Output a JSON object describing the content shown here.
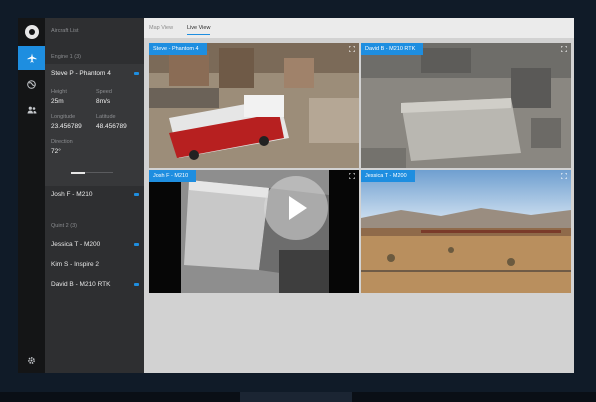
{
  "sidebar_panel": {
    "header": "Aircraft List",
    "groups": [
      {
        "label": "Engine 1 (3)"
      },
      {
        "label": "Quint 2 (3)"
      }
    ],
    "selected": {
      "name": "Steve P - Phantom 4",
      "fields": {
        "height_label": "Height",
        "height_value": "25m",
        "speed_label": "Speed",
        "speed_value": "8m/s",
        "longitude_label": "Longitude",
        "longitude_value": "23.456789",
        "latitude_label": "Latitude",
        "latitude_value": "48.456789",
        "direction_label": "Direction",
        "direction_value": "72°"
      }
    },
    "items": [
      {
        "name": "Josh F - M210"
      },
      {
        "name": "Jessica T - M200"
      },
      {
        "name": "Kim S - Inspire 2"
      },
      {
        "name": "David B - M210 RTK"
      }
    ]
  },
  "tabs": {
    "map": "Map View",
    "live": "Live View"
  },
  "feeds": [
    {
      "label": "Steve - Phantom 4"
    },
    {
      "label": "David B - M210 RTK"
    },
    {
      "label": "Josh F - M210"
    },
    {
      "label": "Jessica T - M200"
    }
  ],
  "icons": {
    "rail": [
      "logo-icon",
      "airplane-icon",
      "globe-icon",
      "users-icon",
      "gear-icon"
    ],
    "feed": [
      "fullscreen-icon",
      "play-icon"
    ]
  },
  "colors": {
    "accent": "#1e8ee0",
    "panel": "#2e2f31",
    "rail": "#141516"
  }
}
